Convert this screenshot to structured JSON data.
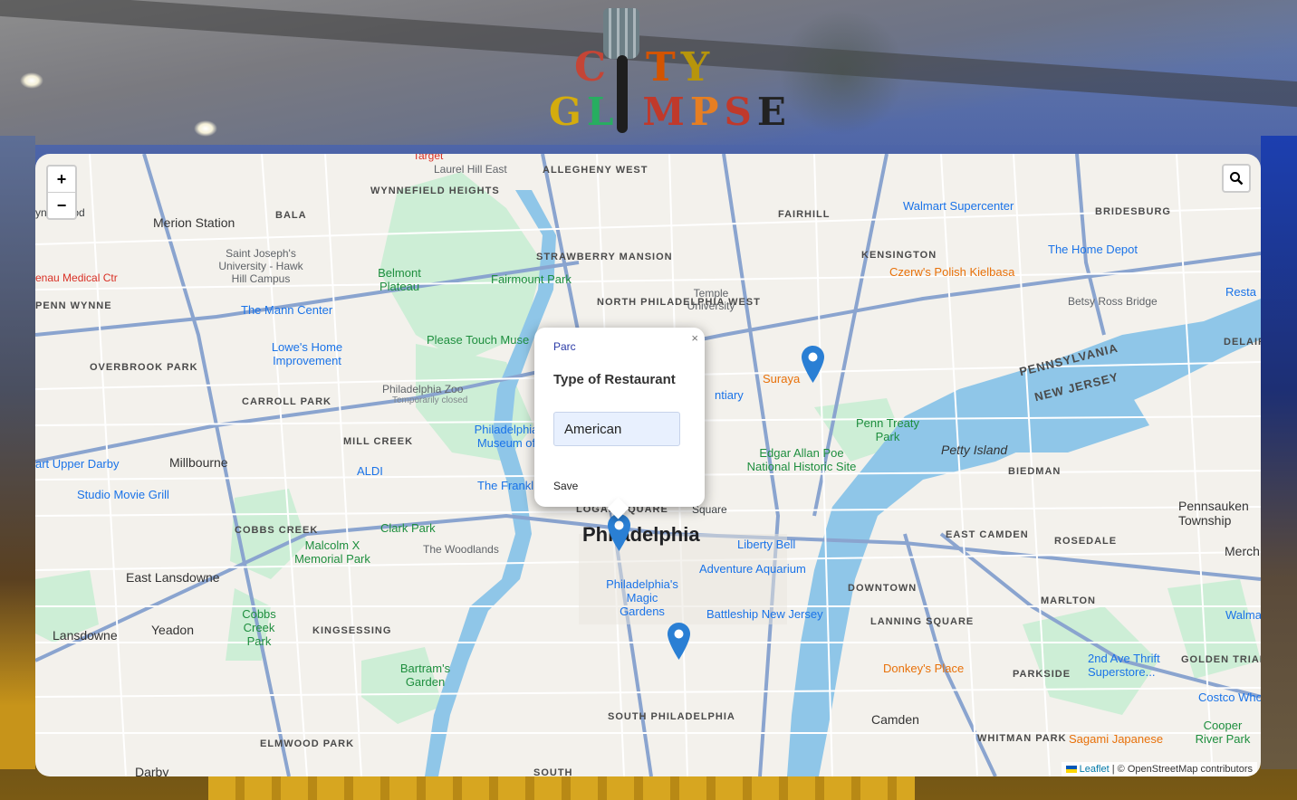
{
  "map": {
    "zoom_in": "+",
    "zoom_out": "−",
    "search_icon": "magnifier-icon",
    "city_label": "Philadelphia",
    "labels": {
      "overbrook_park": "OVERBROOK PARK",
      "wynnefield_heights": "WYNNEFIELD HEIGHTS",
      "bala": "BALA",
      "allegheny_west": "ALLEGHENY WEST",
      "strawberry_mansion": "STRAWBERRY MANSION",
      "north_philadelphia_west": "NORTH PHILADELPHIA WEST",
      "fairhill": "FAIRHILL",
      "kensington": "KENSINGTON",
      "bridesburg": "BRIDESBURG",
      "carroll_park": "CARROLL PARK",
      "mill_creek": "MILL CREEK",
      "cobbs_creek": "COBBS CREEK",
      "kingsessing": "KINGSESSING",
      "elmwood_park": "ELMWOOD PARK",
      "south_philadelphia": "SOUTH PHILADELPHIA",
      "downtown": "DOWNTOWN",
      "lanning_square": "LANNING SQUARE",
      "east_camden": "EAST CAMDEN",
      "rosedale": "ROSEDALE",
      "biedman": "BIEDMAN",
      "marlton": "MARLTON",
      "parkside": "PARKSIDE",
      "whitman_park": "WHITMAN PARK",
      "golden_triangle": "GOLDEN TRIANGLE",
      "penn_wynne": "PENN WYNNE",
      "pennsylvania": "PENNSYLVANIA",
      "new_jersey": "NEW JERSEY",
      "merion_station": "Merion Station",
      "millbourne": "Millbourne",
      "east_lansdowne": "East Lansdowne",
      "lansdowne": "Lansdowne",
      "yeadon": "Yeadon",
      "darby": "Darby",
      "camden": "Camden",
      "petty_island": "Petty Island",
      "pennsauken": "Pennsauken Township",
      "ynnewood": "ynnewood",
      "delair": "DELAIR",
      "south": "SOUTH"
    },
    "places": {
      "saint_josephs": "Saint Joseph's University - Hawk Hill Campus",
      "mann_center": "The Mann Center",
      "lowes": "Lowe's Home Improvement",
      "belmont_plateau": "Belmont Plateau",
      "fairmount_park": "Fairmount Park",
      "please_touch": "Please Touch Muse",
      "philly_zoo": "Philadelphia Zoo",
      "zoo_closed": "Temporarily closed",
      "philly_museum": "Philadelphia Museum of",
      "temple": "Temple University",
      "suraya": "Suraya",
      "penn_treaty": "Penn Treaty Park",
      "edgar_allan_poe": "Edgar Allan Poe National Historic Site",
      "liberty_bell": "Liberty Bell",
      "adventure_aquarium": "Adventure Aquarium",
      "battleship": "Battleship New Jersey",
      "magic_gardens": "Philadelphia's Magic Gardens",
      "clark_park": "Clark Park",
      "woodlands": "The Woodlands",
      "malcolm_x": "Malcolm X Memorial Park",
      "cobbs_creek_park": "Cobbs Creek Park",
      "bartrams": "Bartram's Garden",
      "studio_movie": "Studio Movie Grill",
      "upper_darby": "art Upper Darby",
      "aldi": "ALDI",
      "walmart": "Walmart Supercenter",
      "home_depot": "The Home Depot",
      "czerws": "Czerw's Polish Kielbasa",
      "betsy_ross": "Betsy Ross Bridge",
      "donkeys": "Donkey's Place",
      "second_ave": "2nd Ave Thrift Superstore...",
      "costco": "Costco Who",
      "sagami": "Sagami Japanese",
      "cooper_river": "Cooper River Park",
      "lankenau": "enau Medical Ctr",
      "target": "Target",
      "laurel_hill": "Laurel Hill East",
      "franklin": "The Frankl",
      "logan_square": "LOGAN SQUARE",
      "square": "Square",
      "walma": "Walma",
      "resta": "Resta",
      "merch": "Merch",
      "ntiary": "ntiary"
    },
    "attribution_leaflet": "Leaflet",
    "attribution_sep": "|",
    "attribution_osm": "© OpenStreetMap contributors"
  },
  "logo": {
    "line1": [
      "C",
      "T",
      "Y"
    ],
    "line2": [
      "G",
      "L",
      "M",
      "P",
      "S",
      "E"
    ]
  },
  "popup": {
    "restaurant_name": "Parc",
    "heading": "Type of Restaurant",
    "type_value": "American",
    "save_label": "Save",
    "close_label": "×"
  },
  "colors": {
    "marker": "#2a7fd4",
    "water": "#8fc6e8",
    "park": "#c8ecd2",
    "road_major": "#8aa4cf",
    "road_minor": "#ffffff"
  }
}
